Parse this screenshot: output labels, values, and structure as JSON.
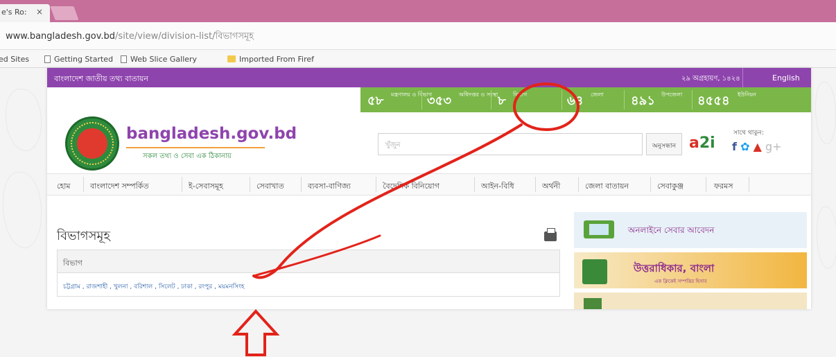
{
  "browser": {
    "tab_title": "e's Ro:",
    "tab_close": "×",
    "url_host": "www.bangladesh.gov.bd",
    "url_path": "/site/view/division-list/বিভাগসমূহ",
    "bookmarks": [
      {
        "label": "ed Sites",
        "icon": "none"
      },
      {
        "label": "Getting Started",
        "icon": "page-icon"
      },
      {
        "label": "Web Slice Gallery",
        "icon": "page-icon"
      },
      {
        "label": "Imported From Firef",
        "icon": "folder-icon"
      }
    ]
  },
  "site": {
    "top_left": "বাংলাদেশ জাতীয় তথ্য বাতায়ন",
    "date": "২৯ অগ্রহায়ণ, ১৪২৪",
    "english": "English",
    "stats": [
      {
        "num": "৫৮",
        "label": "মন্ত্রণালয় ও বিভাগ"
      },
      {
        "num": "৩৫৩",
        "label": "অধিদপ্তর ও সংস্থা"
      },
      {
        "num": "৮",
        "label": "বিভাগ"
      },
      {
        "num": "৬৪",
        "label": "জেলা"
      },
      {
        "num": "৪৯১",
        "label": "উপজেলা"
      },
      {
        "num": "৪৫৫৪",
        "label": "ইউনিয়ন"
      }
    ],
    "brand": "bangladesh.gov.bd",
    "tagline": "সকল তথ্য ও সেবা এক ঠিকানায়",
    "search_placeholder": "খুঁজুন",
    "search_button": "অনুসন্ধান",
    "a2i_logo": "a2i",
    "share_label": "সাথে থাকুন:",
    "nav": [
      "হোম",
      "বাংলাদেশ সম্পর্কিত",
      "ই-সেবাসমূহ",
      "সেবাখাত",
      "ব্যবসা-বাণিজ্য",
      "বৈদেশিক বিনিয়োগ",
      "আইন-বিধি",
      "অর্থনী",
      "জেলা বাতায়ন",
      "সেবাকুঞ্জ",
      "ফরমস"
    ],
    "content_title": "বিভাগসমূহ",
    "table_header": "বিভাগ",
    "divisions_row": "চট্টগ্রাম , রাজশাহী , খুলনা , বরিশাল , সিলেট , ঢাকা , রংপুর , ময়মনসিংহ",
    "sidebar": {
      "online_apply": "অনলাইনে সেবার আবেদন",
      "inheritance_title": "উত্তরাধিকার, বাংলা",
      "inheritance_sub": "এক ক্লিকেই সম্পত্তির হিসাব"
    }
  },
  "colors": {
    "tab_strip": "#c66f9b",
    "site_purple": "#8e44ad",
    "stats_green": "#7ab648",
    "annotation_red": "#e2231a"
  }
}
